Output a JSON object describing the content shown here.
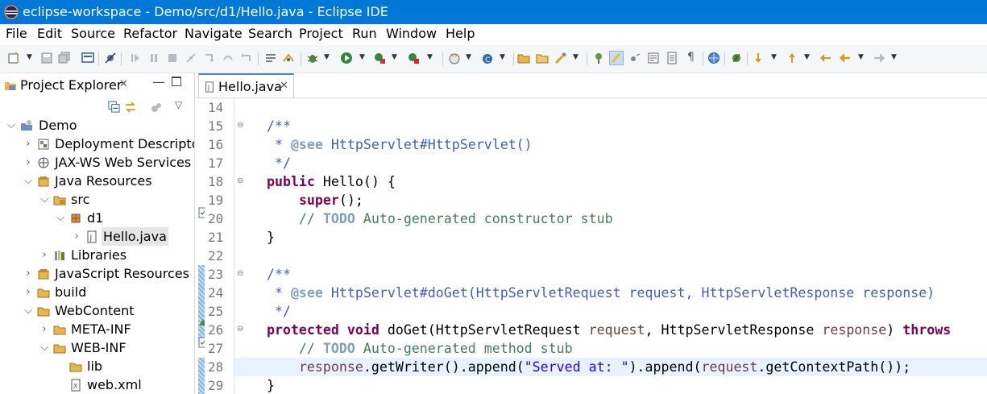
{
  "window": {
    "title": "eclipse-workspace - Demo/src/d1/Hello.java - Eclipse IDE",
    "icon": "eclipse-logo-icon"
  },
  "menu": [
    "File",
    "Edit",
    "Source",
    "Refactor",
    "Navigate",
    "Search",
    "Project",
    "Run",
    "Window",
    "Help"
  ],
  "explorer": {
    "tab_label": "Project Explorer",
    "tree": [
      {
        "label": "Demo",
        "icon": "project-icon",
        "expanded": true
      },
      {
        "label": "Deployment Descriptor",
        "icon": "deployment-descriptor-icon",
        "expanded": false
      },
      {
        "label": "JAX-WS Web Services",
        "icon": "web-services-icon",
        "expanded": false
      },
      {
        "label": "Java Resources",
        "icon": "java-resources-icon",
        "expanded": true
      },
      {
        "label": "src",
        "icon": "source-folder-icon",
        "expanded": true
      },
      {
        "label": "d1",
        "icon": "package-icon",
        "expanded": true
      },
      {
        "label": "Hello.java",
        "icon": "java-file-icon",
        "expanded": false,
        "selected": true
      },
      {
        "label": "Libraries",
        "icon": "libraries-icon",
        "expanded": false
      },
      {
        "label": "JavaScript Resources",
        "icon": "javascript-resources-icon",
        "expanded": false
      },
      {
        "label": "build",
        "icon": "folder-icon",
        "expanded": false
      },
      {
        "label": "WebContent",
        "icon": "folder-icon",
        "expanded": true
      },
      {
        "label": "META-INF",
        "icon": "folder-icon",
        "expanded": false
      },
      {
        "label": "WEB-INF",
        "icon": "folder-icon",
        "expanded": true
      },
      {
        "label": "lib",
        "icon": "folder-icon"
      },
      {
        "label": "web.xml",
        "icon": "xml-file-icon"
      }
    ]
  },
  "editor": {
    "tab_label": "Hello.java",
    "current_line": "28",
    "lines": [
      {
        "num": "14",
        "tokens": []
      },
      {
        "num": "15",
        "tokens": [
          {
            "t": "    ",
            "c": "plain"
          },
          {
            "t": "/**",
            "c": "doc"
          }
        ]
      },
      {
        "num": "16",
        "tokens": [
          {
            "t": "     * ",
            "c": "doc"
          },
          {
            "t": "@see",
            "c": "doctag"
          },
          {
            "t": " ",
            "c": "doc"
          },
          {
            "t": "HttpServlet#HttpServlet()",
            "c": "doclink"
          }
        ]
      },
      {
        "num": "17",
        "tokens": [
          {
            "t": "     */",
            "c": "doc"
          }
        ]
      },
      {
        "num": "18",
        "tokens": [
          {
            "t": "    ",
            "c": "plain"
          },
          {
            "t": "public",
            "c": "kw"
          },
          {
            "t": " Hello() {",
            "c": "plain"
          }
        ]
      },
      {
        "num": "19",
        "tokens": [
          {
            "t": "        ",
            "c": "plain"
          },
          {
            "t": "super",
            "c": "kw"
          },
          {
            "t": "();",
            "c": "plain"
          }
        ]
      },
      {
        "num": "20",
        "tokens": [
          {
            "t": "        // ",
            "c": "comment"
          },
          {
            "t": "TODO",
            "c": "todo"
          },
          {
            "t": " Auto-generated constructor stub",
            "c": "comment"
          }
        ]
      },
      {
        "num": "21",
        "tokens": [
          {
            "t": "    }",
            "c": "plain"
          }
        ]
      },
      {
        "num": "22",
        "tokens": []
      },
      {
        "num": "23",
        "tokens": [
          {
            "t": "    ",
            "c": "plain"
          },
          {
            "t": "/**",
            "c": "doc"
          }
        ]
      },
      {
        "num": "24",
        "tokens": [
          {
            "t": "     * ",
            "c": "doc"
          },
          {
            "t": "@see",
            "c": "doctag"
          },
          {
            "t": " ",
            "c": "doc"
          },
          {
            "t": "HttpServlet#doGet(HttpServletRequest request, HttpServletResponse response)",
            "c": "doclink"
          }
        ]
      },
      {
        "num": "25",
        "tokens": [
          {
            "t": "     */",
            "c": "doc"
          }
        ]
      },
      {
        "num": "26",
        "tokens": [
          {
            "t": "    ",
            "c": "plain"
          },
          {
            "t": "protected",
            "c": "kw"
          },
          {
            "t": " ",
            "c": "plain"
          },
          {
            "t": "void",
            "c": "kw"
          },
          {
            "t": " doGet(HttpServletRequest ",
            "c": "plain"
          },
          {
            "t": "request",
            "c": "param"
          },
          {
            "t": ", HttpServletResponse ",
            "c": "plain"
          },
          {
            "t": "response",
            "c": "param"
          },
          {
            "t": ") ",
            "c": "plain"
          },
          {
            "t": "throws",
            "c": "kw"
          }
        ]
      },
      {
        "num": "27",
        "tokens": [
          {
            "t": "        // ",
            "c": "comment"
          },
          {
            "t": "TODO",
            "c": "todo"
          },
          {
            "t": " Auto-generated method stub",
            "c": "comment"
          }
        ]
      },
      {
        "num": "28",
        "tokens": [
          {
            "t": "        ",
            "c": "plain"
          },
          {
            "t": "response",
            "c": "param"
          },
          {
            "t": ".getWriter().append(",
            "c": "plain"
          },
          {
            "t": "\"Served at: \"",
            "c": "str"
          },
          {
            "t": ").append(",
            "c": "plain"
          },
          {
            "t": "request",
            "c": "param"
          },
          {
            "t": ".getContextPath());",
            "c": "plain"
          }
        ]
      },
      {
        "num": "29",
        "tokens": [
          {
            "t": "    }",
            "c": "plain"
          }
        ]
      }
    ]
  },
  "colors": {
    "titlebar": "#0078d7",
    "keyword": "#7f0055",
    "comment": "#3f7f5f",
    "javadoc": "#3f5fbf",
    "javadoc_tag": "#7f9fbf",
    "string": "#2a00ff",
    "param": "#6a3e3e",
    "todo": "#7f9fbf",
    "current_line": "#e8f2fe"
  }
}
